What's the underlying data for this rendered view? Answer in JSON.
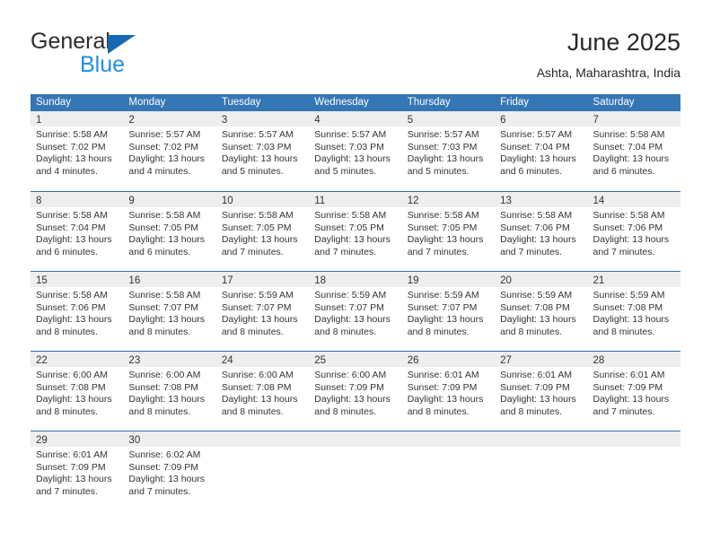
{
  "brand": {
    "name_part1": "General",
    "name_part2": "Blue",
    "triangle_color": "#1469b0",
    "blue_color": "#1f8fe0"
  },
  "header": {
    "title": "June 2025",
    "location": "Ashta, Maharashtra, India"
  },
  "calendar": {
    "accent_color": "#3576b5",
    "weekdays": [
      "Sunday",
      "Monday",
      "Tuesday",
      "Wednesday",
      "Thursday",
      "Friday",
      "Saturday"
    ],
    "weeks": [
      [
        {
          "day": "1",
          "sunrise": "Sunrise: 5:58 AM",
          "sunset": "Sunset: 7:02 PM",
          "daylight_line1": "Daylight: 13 hours",
          "daylight_line2": "and 4 minutes."
        },
        {
          "day": "2",
          "sunrise": "Sunrise: 5:57 AM",
          "sunset": "Sunset: 7:02 PM",
          "daylight_line1": "Daylight: 13 hours",
          "daylight_line2": "and 4 minutes."
        },
        {
          "day": "3",
          "sunrise": "Sunrise: 5:57 AM",
          "sunset": "Sunset: 7:03 PM",
          "daylight_line1": "Daylight: 13 hours",
          "daylight_line2": "and 5 minutes."
        },
        {
          "day": "4",
          "sunrise": "Sunrise: 5:57 AM",
          "sunset": "Sunset: 7:03 PM",
          "daylight_line1": "Daylight: 13 hours",
          "daylight_line2": "and 5 minutes."
        },
        {
          "day": "5",
          "sunrise": "Sunrise: 5:57 AM",
          "sunset": "Sunset: 7:03 PM",
          "daylight_line1": "Daylight: 13 hours",
          "daylight_line2": "and 5 minutes."
        },
        {
          "day": "6",
          "sunrise": "Sunrise: 5:57 AM",
          "sunset": "Sunset: 7:04 PM",
          "daylight_line1": "Daylight: 13 hours",
          "daylight_line2": "and 6 minutes."
        },
        {
          "day": "7",
          "sunrise": "Sunrise: 5:58 AM",
          "sunset": "Sunset: 7:04 PM",
          "daylight_line1": "Daylight: 13 hours",
          "daylight_line2": "and 6 minutes."
        }
      ],
      [
        {
          "day": "8",
          "sunrise": "Sunrise: 5:58 AM",
          "sunset": "Sunset: 7:04 PM",
          "daylight_line1": "Daylight: 13 hours",
          "daylight_line2": "and 6 minutes."
        },
        {
          "day": "9",
          "sunrise": "Sunrise: 5:58 AM",
          "sunset": "Sunset: 7:05 PM",
          "daylight_line1": "Daylight: 13 hours",
          "daylight_line2": "and 6 minutes."
        },
        {
          "day": "10",
          "sunrise": "Sunrise: 5:58 AM",
          "sunset": "Sunset: 7:05 PM",
          "daylight_line1": "Daylight: 13 hours",
          "daylight_line2": "and 7 minutes."
        },
        {
          "day": "11",
          "sunrise": "Sunrise: 5:58 AM",
          "sunset": "Sunset: 7:05 PM",
          "daylight_line1": "Daylight: 13 hours",
          "daylight_line2": "and 7 minutes."
        },
        {
          "day": "12",
          "sunrise": "Sunrise: 5:58 AM",
          "sunset": "Sunset: 7:05 PM",
          "daylight_line1": "Daylight: 13 hours",
          "daylight_line2": "and 7 minutes."
        },
        {
          "day": "13",
          "sunrise": "Sunrise: 5:58 AM",
          "sunset": "Sunset: 7:06 PM",
          "daylight_line1": "Daylight: 13 hours",
          "daylight_line2": "and 7 minutes."
        },
        {
          "day": "14",
          "sunrise": "Sunrise: 5:58 AM",
          "sunset": "Sunset: 7:06 PM",
          "daylight_line1": "Daylight: 13 hours",
          "daylight_line2": "and 7 minutes."
        }
      ],
      [
        {
          "day": "15",
          "sunrise": "Sunrise: 5:58 AM",
          "sunset": "Sunset: 7:06 PM",
          "daylight_line1": "Daylight: 13 hours",
          "daylight_line2": "and 8 minutes."
        },
        {
          "day": "16",
          "sunrise": "Sunrise: 5:58 AM",
          "sunset": "Sunset: 7:07 PM",
          "daylight_line1": "Daylight: 13 hours",
          "daylight_line2": "and 8 minutes."
        },
        {
          "day": "17",
          "sunrise": "Sunrise: 5:59 AM",
          "sunset": "Sunset: 7:07 PM",
          "daylight_line1": "Daylight: 13 hours",
          "daylight_line2": "and 8 minutes."
        },
        {
          "day": "18",
          "sunrise": "Sunrise: 5:59 AM",
          "sunset": "Sunset: 7:07 PM",
          "daylight_line1": "Daylight: 13 hours",
          "daylight_line2": "and 8 minutes."
        },
        {
          "day": "19",
          "sunrise": "Sunrise: 5:59 AM",
          "sunset": "Sunset: 7:07 PM",
          "daylight_line1": "Daylight: 13 hours",
          "daylight_line2": "and 8 minutes."
        },
        {
          "day": "20",
          "sunrise": "Sunrise: 5:59 AM",
          "sunset": "Sunset: 7:08 PM",
          "daylight_line1": "Daylight: 13 hours",
          "daylight_line2": "and 8 minutes."
        },
        {
          "day": "21",
          "sunrise": "Sunrise: 5:59 AM",
          "sunset": "Sunset: 7:08 PM",
          "daylight_line1": "Daylight: 13 hours",
          "daylight_line2": "and 8 minutes."
        }
      ],
      [
        {
          "day": "22",
          "sunrise": "Sunrise: 6:00 AM",
          "sunset": "Sunset: 7:08 PM",
          "daylight_line1": "Daylight: 13 hours",
          "daylight_line2": "and 8 minutes."
        },
        {
          "day": "23",
          "sunrise": "Sunrise: 6:00 AM",
          "sunset": "Sunset: 7:08 PM",
          "daylight_line1": "Daylight: 13 hours",
          "daylight_line2": "and 8 minutes."
        },
        {
          "day": "24",
          "sunrise": "Sunrise: 6:00 AM",
          "sunset": "Sunset: 7:08 PM",
          "daylight_line1": "Daylight: 13 hours",
          "daylight_line2": "and 8 minutes."
        },
        {
          "day": "25",
          "sunrise": "Sunrise: 6:00 AM",
          "sunset": "Sunset: 7:09 PM",
          "daylight_line1": "Daylight: 13 hours",
          "daylight_line2": "and 8 minutes."
        },
        {
          "day": "26",
          "sunrise": "Sunrise: 6:01 AM",
          "sunset": "Sunset: 7:09 PM",
          "daylight_line1": "Daylight: 13 hours",
          "daylight_line2": "and 8 minutes."
        },
        {
          "day": "27",
          "sunrise": "Sunrise: 6:01 AM",
          "sunset": "Sunset: 7:09 PM",
          "daylight_line1": "Daylight: 13 hours",
          "daylight_line2": "and 8 minutes."
        },
        {
          "day": "28",
          "sunrise": "Sunrise: 6:01 AM",
          "sunset": "Sunset: 7:09 PM",
          "daylight_line1": "Daylight: 13 hours",
          "daylight_line2": "and 7 minutes."
        }
      ],
      [
        {
          "day": "29",
          "sunrise": "Sunrise: 6:01 AM",
          "sunset": "Sunset: 7:09 PM",
          "daylight_line1": "Daylight: 13 hours",
          "daylight_line2": "and 7 minutes."
        },
        {
          "day": "30",
          "sunrise": "Sunrise: 6:02 AM",
          "sunset": "Sunset: 7:09 PM",
          "daylight_line1": "Daylight: 13 hours",
          "daylight_line2": "and 7 minutes."
        },
        {
          "day": "",
          "sunrise": "",
          "sunset": "",
          "daylight_line1": "",
          "daylight_line2": ""
        },
        {
          "day": "",
          "sunrise": "",
          "sunset": "",
          "daylight_line1": "",
          "daylight_line2": ""
        },
        {
          "day": "",
          "sunrise": "",
          "sunset": "",
          "daylight_line1": "",
          "daylight_line2": ""
        },
        {
          "day": "",
          "sunrise": "",
          "sunset": "",
          "daylight_line1": "",
          "daylight_line2": ""
        },
        {
          "day": "",
          "sunrise": "",
          "sunset": "",
          "daylight_line1": "",
          "daylight_line2": ""
        }
      ]
    ]
  }
}
